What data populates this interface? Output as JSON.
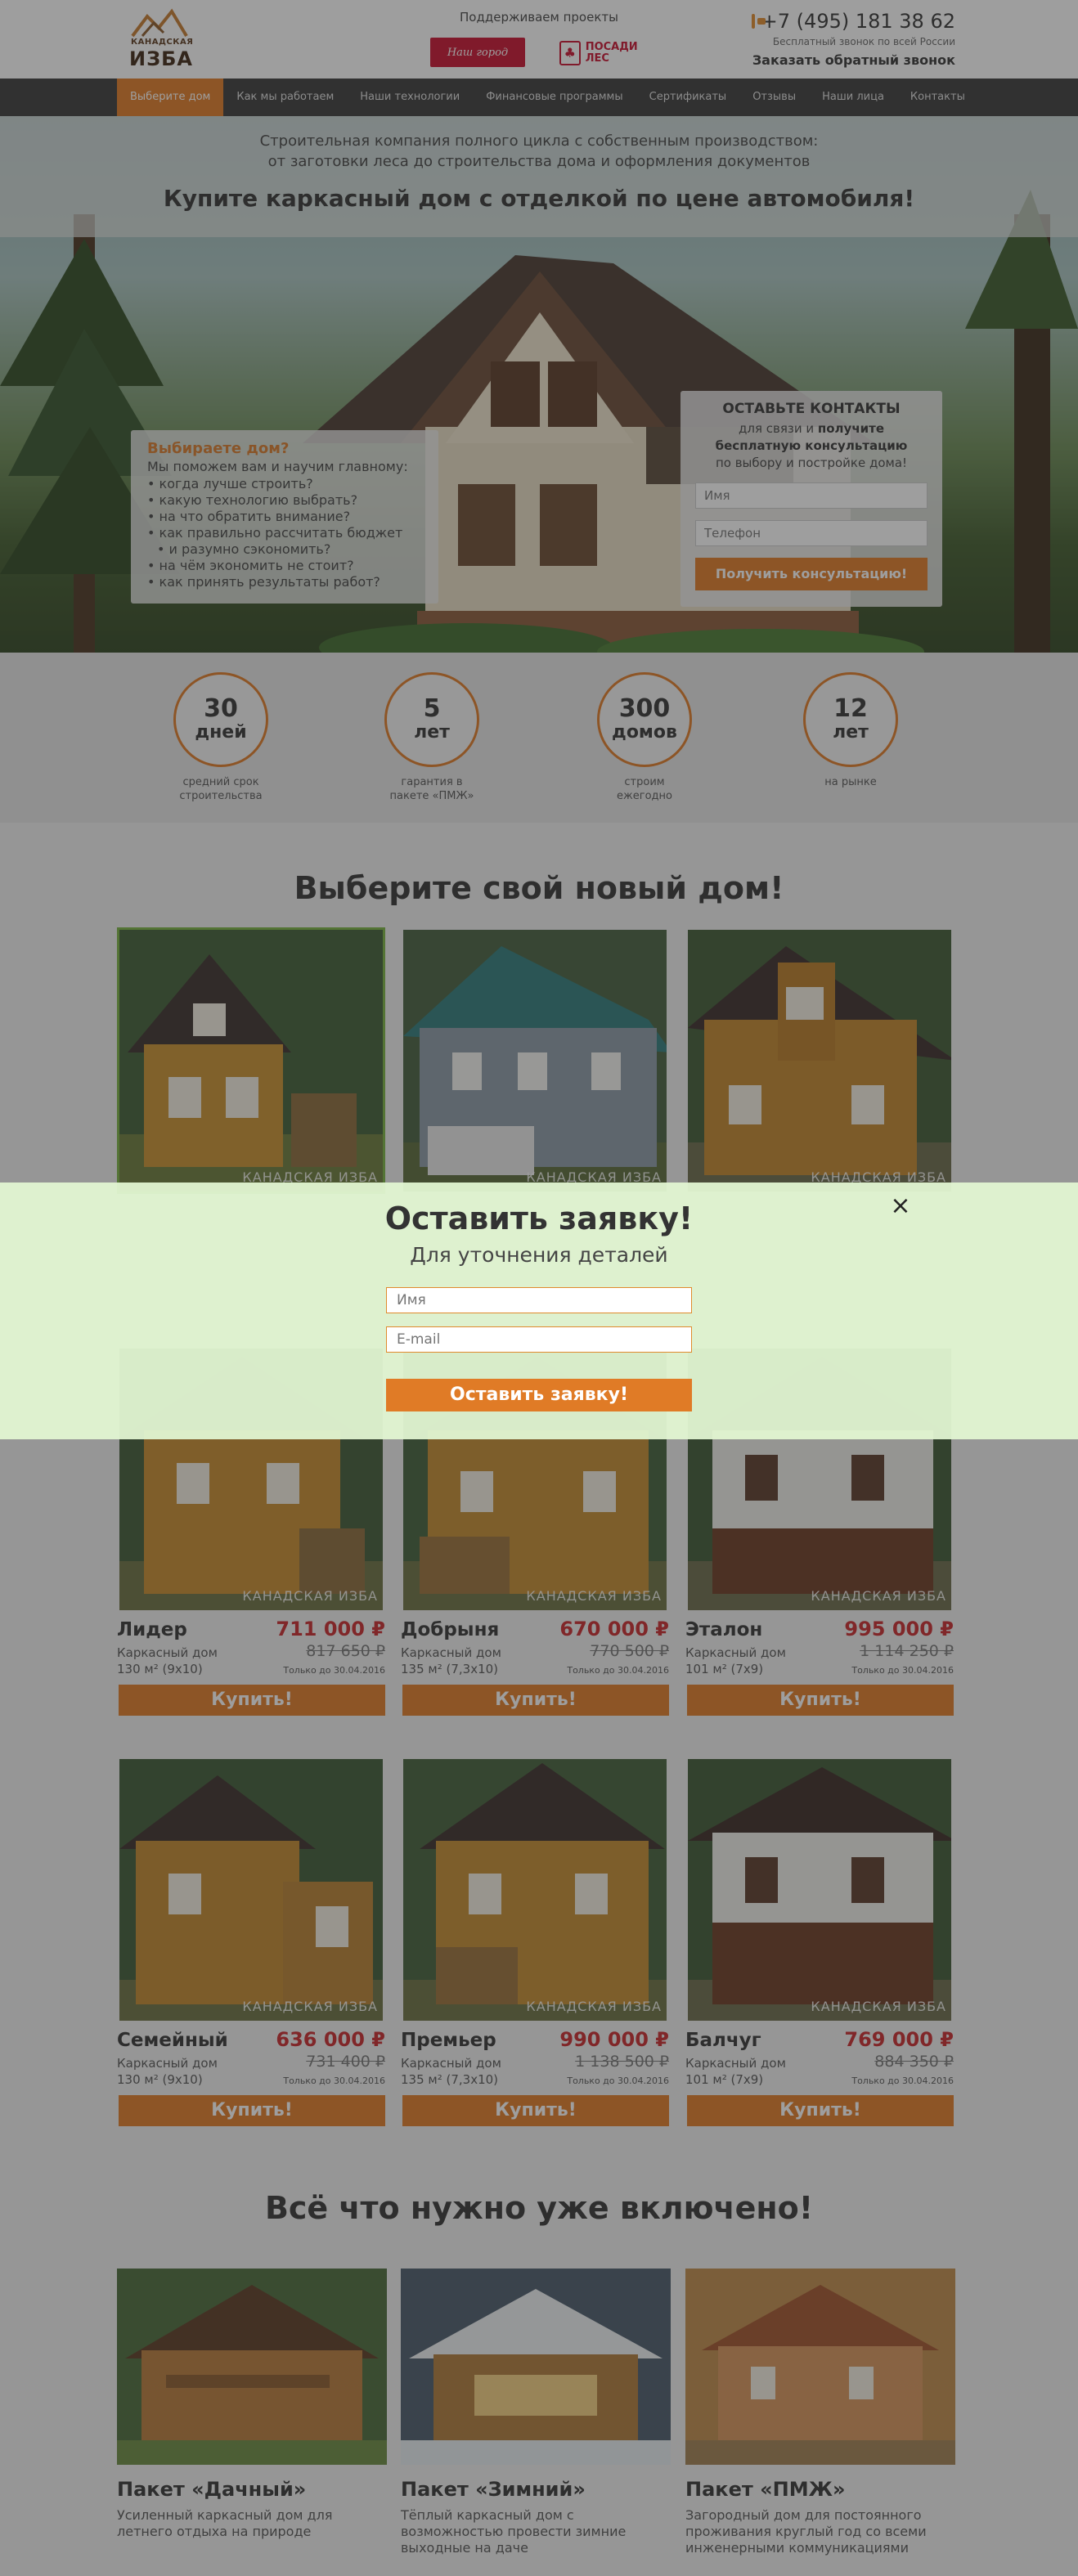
{
  "header": {
    "logo_top": "КАНАДСКАЯ",
    "logo_bottom": "ИЗБА",
    "support_label": "Поддерживаем проекты",
    "partner1": "Наш город",
    "partner2": "ПОСАДИ ЛЕС",
    "phone": "+7 (495) 181 38 62",
    "free_call": "Бесплатный звонок по всей России",
    "callback": "Заказать обратный звонок"
  },
  "nav": [
    "Выберите дом",
    "Как мы работаем",
    "Наши технологии",
    "Финансовые программы",
    "Сертификаты",
    "Отзывы",
    "Наши лица",
    "Контакты"
  ],
  "hero": {
    "subtitle_line1": "Строительная компания полного цикла с собственным производством:",
    "subtitle_line2": "от заготовки леса до строительства дома и оформления документов",
    "title": "Купите каркасный дом с отделкой по цене автомобиля!",
    "left_title": "Выбираете дом?",
    "left_intro": "Мы поможем вам и научим главному:",
    "left_items": [
      "когда лучше строить?",
      "какую технологию выбрать?",
      "на что обратить внимание?",
      "как правильно рассчитать бюджет",
      "и разумно сэкономить?",
      "на чём экономить не стоит?",
      "как принять результаты работ?"
    ],
    "form_title": "ОСТАВЬТЕ КОНТАКТЫ",
    "form_text1": "для связи и",
    "form_text2": "получите",
    "form_text3": "бесплатную консультацию",
    "form_text4": "по выбору и постройке дома!",
    "name_placeholder": "Имя",
    "phone_placeholder": "Телефон",
    "button": "Получить консультацию!"
  },
  "stats": [
    {
      "num": "30",
      "unit": "дней",
      "cap1": "средний срок",
      "cap2": "строительства"
    },
    {
      "num": "5",
      "unit": "лет",
      "cap1": "гарантия в",
      "cap2": "пакете «ПМЖ»"
    },
    {
      "num": "300",
      "unit": "домов",
      "cap1": "строим",
      "cap2": "ежегодно"
    },
    {
      "num": "12",
      "unit": "лет",
      "cap1": "на рынке",
      "cap2": ""
    }
  ],
  "catalog": {
    "title": "Выберите свой новый дом!",
    "watermark": "КАНАДСКАЯ ИЗБА",
    "buy_label": "Купить!",
    "houses": [
      {
        "name": "",
        "type": "",
        "area": "",
        "price": "",
        "old": "",
        "until": ""
      },
      {
        "name": "",
        "type": "",
        "area": "",
        "price": "",
        "old": "",
        "until": ""
      },
      {
        "name": "",
        "type": "",
        "area": "",
        "price": "",
        "old": "",
        "until": ""
      },
      {
        "name": "Лидер",
        "type": "Каркасный дом",
        "area": "130 м² (9х10)",
        "price": "711 000 ₽",
        "old": "817 650 ₽",
        "until": "Только до 30.04.2016"
      },
      {
        "name": "Добрыня",
        "type": "Каркасный дом",
        "area": "135 м² (7,3х10)",
        "price": "670 000 ₽",
        "old": "770 500 ₽",
        "until": "Только до 30.04.2016"
      },
      {
        "name": "Эталон",
        "type": "Каркасный дом",
        "area": "101 м² (7х9)",
        "price": "995 000 ₽",
        "old": "1 114 250 ₽",
        "until": "Только до 30.04.2016"
      },
      {
        "name": "Семейный",
        "type": "Каркасный дом",
        "area": "130 м² (9х10)",
        "price": "636 000 ₽",
        "old": "731 400 ₽",
        "until": "Только до 30.04.2016"
      },
      {
        "name": "Премьер",
        "type": "Каркасный дом",
        "area": "135 м² (7,3х10)",
        "price": "990 000 ₽",
        "old": "1 138 500 ₽",
        "until": "Только до 30.04.2016"
      },
      {
        "name": "Балчуг",
        "type": "Каркасный дом",
        "area": "101 м² (7х9)",
        "price": "769 000 ₽",
        "old": "884 350 ₽",
        "until": "Только до 30.04.2016"
      }
    ]
  },
  "packages": {
    "title": "Всё что нужно уже включено!",
    "items": [
      {
        "title": "Пакет «Дачный»",
        "desc": "Усиленный каркасный дом для летнего отдыха на природе"
      },
      {
        "title": "Пакет «Зимний»",
        "desc": "Тёплый каркасный дом с возможностью провести зимние выходные на даче"
      },
      {
        "title": "Пакет «ПМЖ»",
        "desc": "Загородный дом для постоянного проживания круглый год со всеми инженерными коммуникациями"
      }
    ]
  },
  "modal": {
    "title": "Оставить заявку!",
    "subtitle": "Для уточнения деталей",
    "name_placeholder": "Имя",
    "email_placeholder": "E-mail",
    "button": "Оставить заявку!",
    "close": "×"
  },
  "colors": {
    "accent": "#e07b26",
    "price": "#c9272b",
    "nav": "#3a3a3a",
    "modal_bg": "#e2f6d2",
    "selected_border": "#78b341"
  }
}
